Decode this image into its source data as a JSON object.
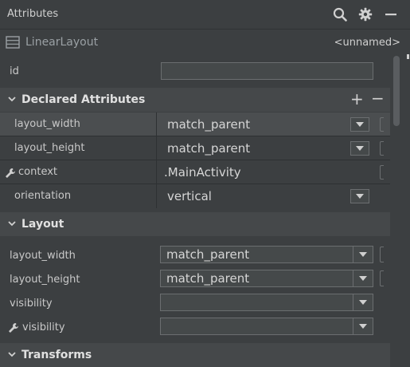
{
  "panel": {
    "title": "Attributes",
    "icons": [
      "search-icon",
      "gear-icon",
      "minimize-icon"
    ]
  },
  "component": {
    "type": "LinearLayout",
    "name": "<unnamed>"
  },
  "id_field": {
    "label": "id",
    "value": ""
  },
  "declared": {
    "title": "Declared Attributes",
    "add": "+",
    "remove": "−",
    "rows": [
      {
        "label": "layout_width",
        "value": "match_parent"
      },
      {
        "label": "layout_height",
        "value": "match_parent"
      },
      {
        "label": "context",
        "value": ".MainActivity"
      },
      {
        "label": "orientation",
        "value": "vertical"
      }
    ]
  },
  "layout": {
    "title": "Layout",
    "rows": [
      {
        "label": "layout_width",
        "value": "match_parent"
      },
      {
        "label": "layout_height",
        "value": "match_parent"
      },
      {
        "label": "visibility",
        "value": ""
      },
      {
        "label": "visibility",
        "value": ""
      }
    ]
  },
  "transforms": {
    "title": "Transforms"
  },
  "colors": {
    "bg": "#3c3f41",
    "section": "#45484a",
    "border": "#6b6e70"
  }
}
